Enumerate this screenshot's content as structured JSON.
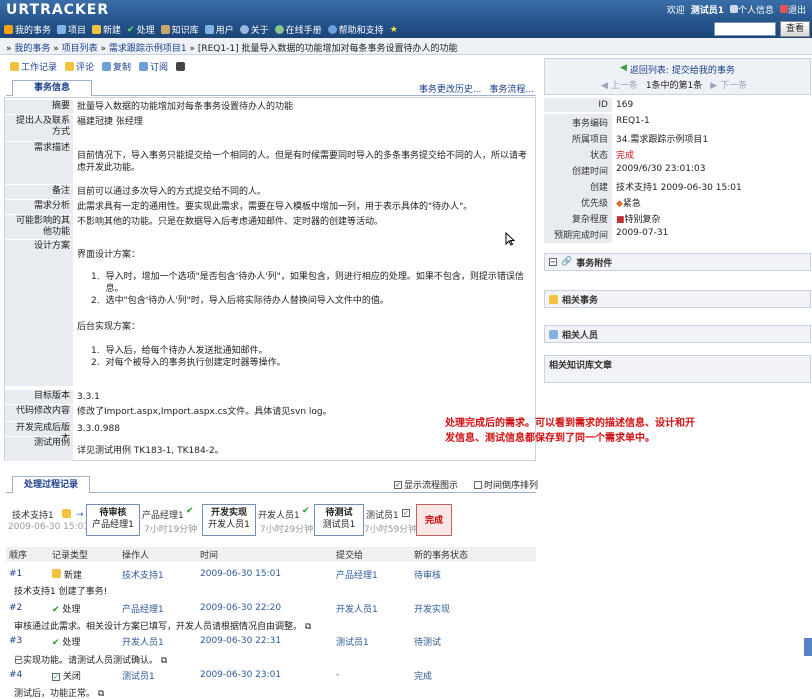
{
  "app": {
    "logo": "URTRACKER"
  },
  "topnav": [
    {
      "label": "我的事务",
      "icon": "home-icon",
      "color": "#f4a300"
    },
    {
      "label": "项目",
      "icon": "project-icon",
      "color": "#7fb3e6"
    },
    {
      "label": "新建",
      "icon": "new-icon",
      "color": "#f3c23c"
    },
    {
      "label": "处理",
      "icon": "check-icon",
      "color": "#5ec45e"
    },
    {
      "label": "知识库",
      "icon": "book-icon",
      "color": "#c9a76b"
    },
    {
      "label": "用户",
      "icon": "users-icon",
      "color": "#7fb3e6"
    },
    {
      "label": "关于",
      "icon": "info-icon",
      "color": "#9bb8e0"
    },
    {
      "label": "在线手册",
      "icon": "manual-icon",
      "color": "#8bc48b"
    },
    {
      "label": "帮助和支持",
      "icon": "help-icon",
      "color": "#6aa0e0"
    }
  ],
  "user": {
    "welcome": "欢迎",
    "name": "测试员1",
    "profile": "个人信息",
    "logout": "退出"
  },
  "search": {
    "button": "查看",
    "value": ""
  },
  "breadcrumb": {
    "items": [
      "我的事务",
      "项目列表",
      "需求跟踪示例项目1"
    ],
    "current": "[REQ1-1] 批量导入数据的功能增加对每条事务设置待办人的功能"
  },
  "actions": [
    {
      "label": "工作记录",
      "icon": "worklog-icon"
    },
    {
      "label": "评论",
      "icon": "comment-icon"
    },
    {
      "label": "复制",
      "icon": "copy-icon"
    },
    {
      "label": "订阅",
      "icon": "subscribe-icon"
    },
    {
      "label": "",
      "icon": "print-icon"
    }
  ],
  "tabs": {
    "active": "事务信息",
    "links": [
      "事务更改历史...",
      "事务流程..."
    ]
  },
  "fields": {
    "summary_l": "摘要",
    "summary": "批量导入数据的功能增加对每条事务设置待办人的功能",
    "submitter_l": "提出人及联系方式",
    "submitter": "福建冠捷 张经理",
    "desc_l": "需求描述",
    "desc": "目前情况下，导入事务只能提交给一个相同的人。但是有时候需要同时导入的多条事务提交给不同的人，所以请考虑开发此功能。",
    "remark_l": "备注",
    "remark": "目前可以通过多次导入的方式提交给不同的人。",
    "analysis_l": "需求分析",
    "analysis": "此需求具有一定的通用性。要实现此需求，需要在导入模板中增加一列，用于表示具体的\"待办人\"。",
    "impact_l": "可能影响的其他功能",
    "impact": "不影响其他的功能。只是在数据导入后考虑通知邮件、定时器的创建等活动。",
    "design_l": "设计方案",
    "design_front": "界面设计方案：",
    "design_f1": "导入时，增加一个选项\"是否包含'待办人'列\"，如果包含，则进行相应的处理。如果不包含，则提示错误信息。",
    "design_f2": "选中\"包含'待办人'列\"时，导入后将实际待办人替换间导入文件中的值。",
    "design_back": "后台实现方案：",
    "design_b1": "导入后，给每个待办人发送批通知邮件。",
    "design_b2": "对每个被导入的事务执行创建定时器等操作。",
    "target_l": "目标版本",
    "target": "3.3.1",
    "code_l": "代码修改内容",
    "code": "修改了Import.aspx,Import.aspx.cs文件。具体请见svn log。",
    "release_l": "开发完成后版本",
    "release": "3.3.0.988",
    "test_l": "测试用例",
    "test": "详见测试用例 TK183-1, TK184-2。"
  },
  "annotation": "处理完成后的需求。可以看到需求的描述信息、设计和开发信息、测试信息都保存到了同一个需求单中。",
  "right": {
    "back": "返回列表: 提交给我的事务",
    "prev": "上一条",
    "pos": "1条中的第1条",
    "next": "下一条",
    "props": [
      {
        "k": "ID",
        "v": "169"
      },
      {
        "k": "事务编码",
        "v": "REQ1-1"
      },
      {
        "k": "所属项目",
        "v": "34.需求跟踪示例项目1"
      },
      {
        "k": "状态",
        "v": "完成"
      },
      {
        "k": "创建时间",
        "v": "2009/6/30 23:01:03"
      },
      {
        "k": "创建",
        "v": "技术支持1 2009-06-30 15:01"
      },
      {
        "k": "优先级",
        "v": "紧急"
      },
      {
        "k": "复杂程度",
        "v": "特别复杂"
      },
      {
        "k": "预期完成时间",
        "v": "2009-07-31"
      }
    ],
    "sections": [
      "事务附件",
      "相关事务",
      "相关人员",
      "相关知识库文章"
    ]
  },
  "process": {
    "tab": "处理过程记录",
    "show_flow": "显示流程图示",
    "time_order": "时间倒序排列",
    "flow": [
      {
        "who": "技术支持1",
        "time": "2009-06-30 15:01"
      },
      {
        "step": "待审核",
        "who": "产品经理1",
        "next": "产品经理1",
        "dur": "7小时19分钟"
      },
      {
        "step": "开发实现",
        "who": "开发人员1",
        "next": "开发人员1",
        "dur": "7小时29分钟"
      },
      {
        "step": "待测试",
        "who": "测试员1",
        "next": "测试员1",
        "dur": "7小时59分钟"
      },
      {
        "step": "完成"
      }
    ],
    "headers": [
      "顺序",
      "记录类型",
      "操作人",
      "时间",
      "提交给",
      "新的事务状态"
    ],
    "records": [
      {
        "no": "#1",
        "type": "新建",
        "op": "技术支持1",
        "time": "2009-06-30 15:01",
        "to": "产品经理1",
        "state": "待审核",
        "note": "技术支持1 创建了事务!"
      },
      {
        "no": "#2",
        "type": "处理",
        "op": "产品经理1",
        "time": "2009-06-30 22:20",
        "to": "开发人员1",
        "state": "开发实现",
        "note": "审核通过此需求。相关设计方案已填写，开发人员请根据情况自由调整。"
      },
      {
        "no": "#3",
        "type": "处理",
        "op": "开发人员1",
        "time": "2009-06-30 22:31",
        "to": "测试员1",
        "state": "待测试",
        "note": "已实现功能。请测试人员测试确认。"
      },
      {
        "no": "#4",
        "type": "关闭",
        "op": "测试员1",
        "time": "2009-06-30 23:01",
        "to": "-",
        "state": "完成",
        "note": "测试后，功能正常。"
      }
    ]
  }
}
